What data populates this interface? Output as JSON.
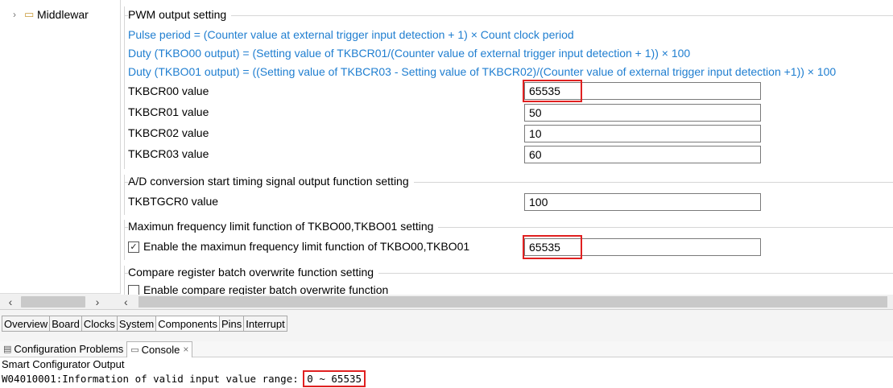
{
  "tree": {
    "item_label": "Middlewar"
  },
  "groups": {
    "pwm": {
      "title": "PWM output setting",
      "formulas": [
        "Pulse period = (Counter value at external trigger input detection + 1) × Count clock period",
        "Duty (TKBO00 output) = (Setting value of TKBCR01/(Counter value of external trigger input detection + 1)) × 100",
        "Duty (TKBO01 output) = ((Setting value of TKBCR03 - Setting value of TKBCR02)/(Counter value of external trigger input detection +1)) × 100"
      ],
      "fields": [
        {
          "label": "TKBCR00 value",
          "value": "65535"
        },
        {
          "label": "TKBCR01 value",
          "value": "50"
        },
        {
          "label": "TKBCR02 value",
          "value": "10"
        },
        {
          "label": "TKBCR03 value",
          "value": "60"
        }
      ]
    },
    "ad": {
      "title": "A/D conversion start timing signal output function setting",
      "field": {
        "label": "TKBTGCR0 value",
        "value": "100"
      }
    },
    "maxfreq": {
      "title": "Maximun frequency limit function of TKBO00,TKBO01 setting",
      "checkbox_label": "Enable the maximun frequency limit function of TKBO00,TKBO01",
      "checked": true,
      "value": "65535"
    },
    "compare": {
      "title": "Compare register batch overwrite function setting",
      "checkbox_label": "Enable compare register batch overwrite function",
      "checked": false
    }
  },
  "tabs": [
    "Overview",
    "Board",
    "Clocks",
    "System",
    "Components",
    "Pins",
    "Interrupt"
  ],
  "active_tab": "Components",
  "console": {
    "tabs": [
      {
        "label": "Configuration Problems",
        "active": false
      },
      {
        "label": "Console",
        "active": true
      }
    ],
    "title": "Smart Configurator Output",
    "message_prefix": "W04010001:Information of valid input value range: ",
    "message_range": "0 ~ 65535"
  },
  "colors": {
    "formula": "#1f7ed0",
    "highlight": "#e02020"
  }
}
